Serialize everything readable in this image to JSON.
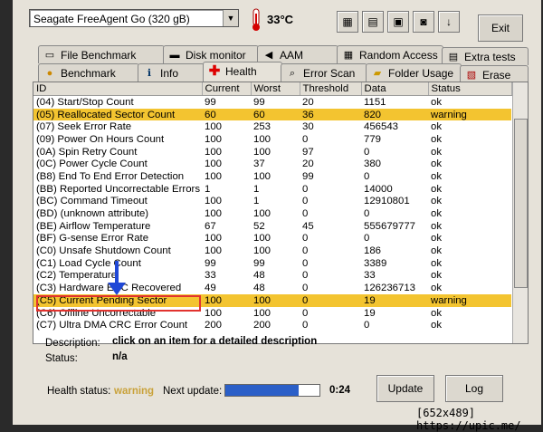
{
  "drive_select": {
    "value": "Seagate FreeAgent Go    (320 gB)"
  },
  "temperature": "33°C",
  "exit_label": "Exit",
  "tabs_row1": [
    {
      "label": "File Benchmark",
      "icon": "file-icon"
    },
    {
      "label": "Disk monitor",
      "icon": "monitor-icon"
    },
    {
      "label": "AAM",
      "icon": "speaker-icon"
    },
    {
      "label": "Random Access",
      "icon": "random-access-icon"
    },
    {
      "label": "Extra tests",
      "icon": "tests-icon"
    }
  ],
  "tabs_row2": [
    {
      "label": "Benchmark",
      "icon": "bulb-icon"
    },
    {
      "label": "Info",
      "icon": "info-icon"
    },
    {
      "label": "Health",
      "icon": "health-cross-icon"
    },
    {
      "label": "Error Scan",
      "icon": "magnifier-icon"
    },
    {
      "label": "Folder Usage",
      "icon": "folder-icon"
    },
    {
      "label": "Erase",
      "icon": "erase-icon"
    }
  ],
  "table": {
    "headers": [
      "ID",
      "Current",
      "Worst",
      "Threshold",
      "Data",
      "Status"
    ],
    "rows": [
      {
        "id": "(04) Start/Stop Count",
        "current": "99",
        "worst": "99",
        "threshold": "20",
        "data": "1151",
        "status": "ok"
      },
      {
        "id": "(05) Reallocated Sector Count",
        "current": "60",
        "worst": "60",
        "threshold": "36",
        "data": "820",
        "status": "warning"
      },
      {
        "id": "(07) Seek Error Rate",
        "current": "100",
        "worst": "253",
        "threshold": "30",
        "data": "456543",
        "status": "ok"
      },
      {
        "id": "(09) Power On Hours Count",
        "current": "100",
        "worst": "100",
        "threshold": "0",
        "data": "779",
        "status": "ok"
      },
      {
        "id": "(0A) Spin Retry Count",
        "current": "100",
        "worst": "100",
        "threshold": "97",
        "data": "0",
        "status": "ok"
      },
      {
        "id": "(0C) Power Cycle Count",
        "current": "100",
        "worst": "37",
        "threshold": "20",
        "data": "380",
        "status": "ok"
      },
      {
        "id": "(B8) End To End Error Detection",
        "current": "100",
        "worst": "100",
        "threshold": "99",
        "data": "0",
        "status": "ok"
      },
      {
        "id": "(BB) Reported Uncorrectable Errors",
        "current": "1",
        "worst": "1",
        "threshold": "0",
        "data": "14000",
        "status": "ok"
      },
      {
        "id": "(BC) Command Timeout",
        "current": "100",
        "worst": "1",
        "threshold": "0",
        "data": "12910801",
        "status": "ok"
      },
      {
        "id": "(BD) (unknown attribute)",
        "current": "100",
        "worst": "100",
        "threshold": "0",
        "data": "0",
        "status": "ok"
      },
      {
        "id": "(BE) Airflow Temperature",
        "current": "67",
        "worst": "52",
        "threshold": "45",
        "data": "555679777",
        "status": "ok"
      },
      {
        "id": "(BF) G-sense Error Rate",
        "current": "100",
        "worst": "100",
        "threshold": "0",
        "data": "0",
        "status": "ok"
      },
      {
        "id": "(C0) Unsafe Shutdown Count",
        "current": "100",
        "worst": "100",
        "threshold": "0",
        "data": "186",
        "status": "ok"
      },
      {
        "id": "(C1) Load Cycle Count",
        "current": "99",
        "worst": "99",
        "threshold": "0",
        "data": "3389",
        "status": "ok"
      },
      {
        "id": "(C2) Temperature",
        "current": "33",
        "worst": "48",
        "threshold": "0",
        "data": "33",
        "status": "ok"
      },
      {
        "id": "(C3) Hardware ECC Recovered",
        "current": "49",
        "worst": "48",
        "threshold": "0",
        "data": "126236713",
        "status": "ok"
      },
      {
        "id": "(C5) Current Pending Sector",
        "current": "100",
        "worst": "100",
        "threshold": "0",
        "data": "19",
        "status": "warning"
      },
      {
        "id": "(C6) Offline Uncorrectable",
        "current": "100",
        "worst": "100",
        "threshold": "0",
        "data": "19",
        "status": "ok"
      },
      {
        "id": "(C7) Ultra DMA CRC Error Count",
        "current": "200",
        "worst": "200",
        "threshold": "0",
        "data": "0",
        "status": "ok"
      }
    ]
  },
  "description": {
    "label": "Description:",
    "value": "click on an item for a detailed description"
  },
  "status": {
    "label": "Status:",
    "value": "n/a"
  },
  "health_status": {
    "label": "Health status:",
    "value": "warning",
    "color": "#c9a23a"
  },
  "next_update": {
    "label": "Next update:",
    "time": "0:24",
    "progress": 0.78
  },
  "buttons": {
    "update": "Update",
    "log": "Log"
  },
  "watermark": "[652x489] https://upic.me/",
  "colors": {
    "warning_row": "#f3c430",
    "highlight_box": "#e2332f",
    "arrow": "#2048d6"
  }
}
